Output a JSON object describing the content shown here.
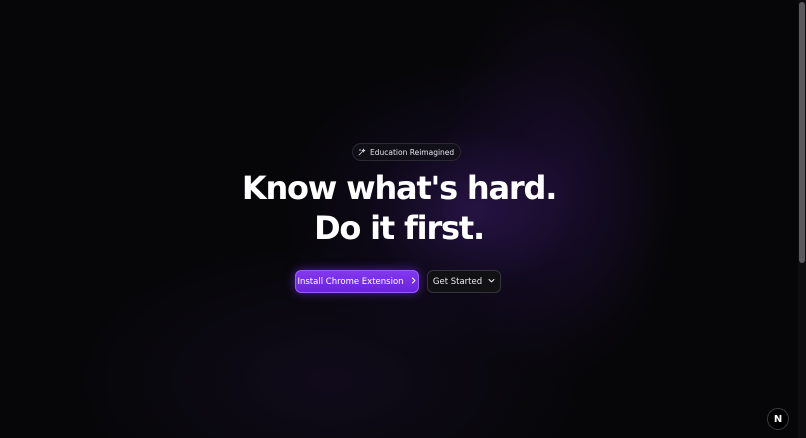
{
  "hero": {
    "badge": {
      "icon": "sparkle-icon",
      "label": "Education Reimagined"
    },
    "headline_line1": "Know what's hard.",
    "headline_line2": "Do it first.",
    "primary_button": {
      "label": "Install Chrome Extension",
      "icon": "chevron-right-icon"
    },
    "secondary_button": {
      "label": "Get Started",
      "icon": "chevron-down-icon"
    }
  },
  "dev_indicator": {
    "letter": "N"
  },
  "colors": {
    "background": "#060608",
    "accent": "#7b2ff0",
    "text": "#ffffff"
  }
}
